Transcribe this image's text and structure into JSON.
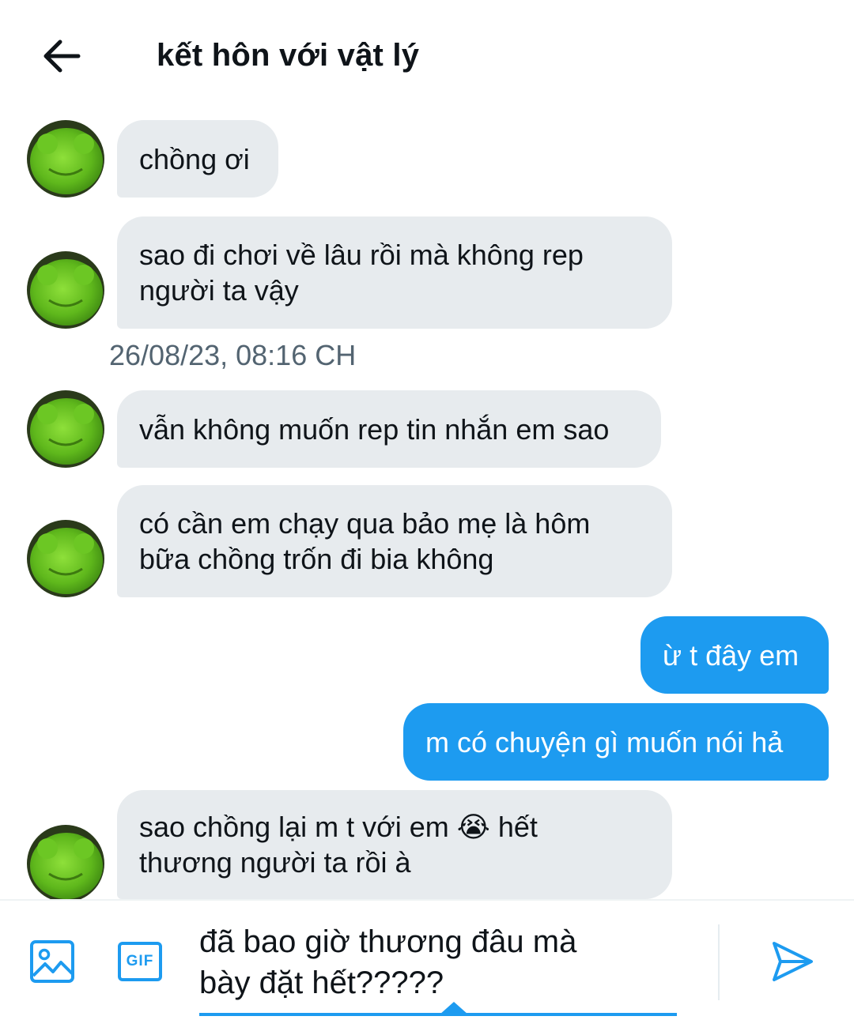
{
  "header": {
    "title": "kết hôn với vật lý"
  },
  "messages": [
    {
      "direction": "in",
      "text_lines": [
        "chồng ơi"
      ]
    },
    {
      "direction": "in",
      "text_lines": [
        "sao đi chơi về lâu rồi mà không rep",
        "người ta vậy"
      ]
    },
    {
      "direction": "in",
      "text_lines": [
        "vẫn không muốn rep tin nhắn em sao"
      ]
    },
    {
      "direction": "in",
      "text_lines": [
        "có cần em chạy qua bảo mẹ là hôm",
        "bữa chồng trốn đi bia không"
      ]
    },
    {
      "direction": "out",
      "text_lines": [
        "ừ t đây em"
      ]
    },
    {
      "direction": "out",
      "text_lines": [
        "m có chuyện gì muốn nói hả"
      ]
    },
    {
      "direction": "in",
      "text_lines": [
        "sao chồng lại m t với em 😭 hết",
        "thương người ta rồi à"
      ]
    }
  ],
  "timestamp": "26/08/23, 08:16 CH",
  "composer": {
    "value_lines": [
      "đã bao giờ thương đâu mà",
      "bày đặt hết?????"
    ],
    "gif_label": "GIF"
  },
  "icons": {
    "back": "arrow-left-icon",
    "image": "image-icon",
    "gif": "gif-icon",
    "send": "send-icon"
  },
  "colors": {
    "accent": "#1d9bf0",
    "incoming_bubble": "#e7ebee",
    "muted_text": "#536471",
    "avatar_green": "#66c21e"
  }
}
